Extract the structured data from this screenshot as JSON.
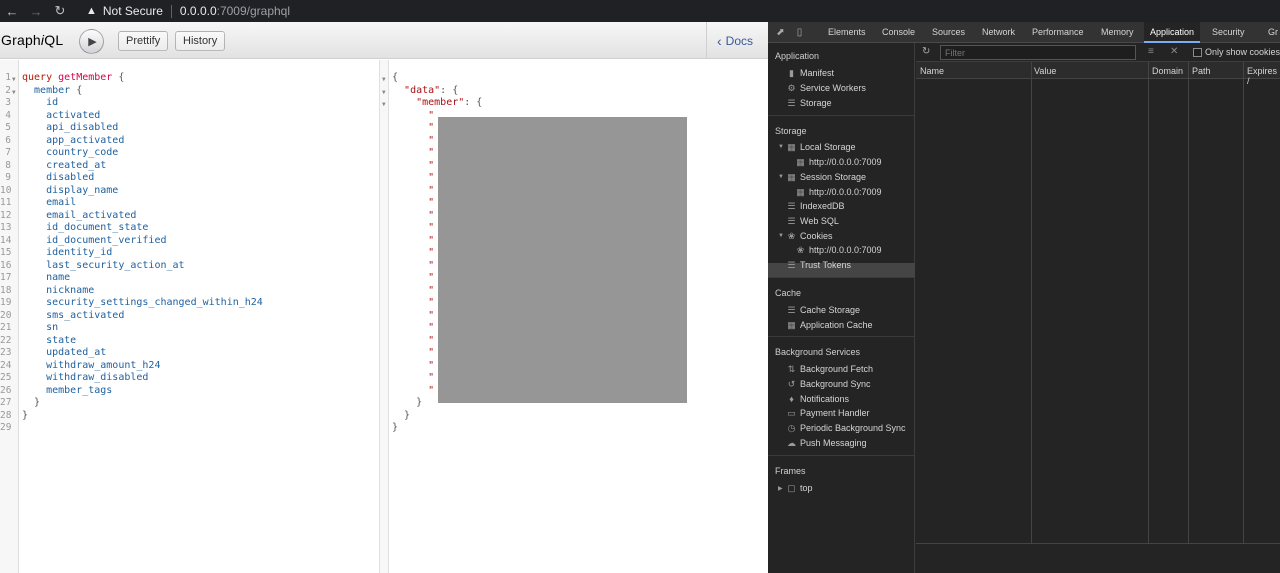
{
  "browser": {
    "security_label": "Not Secure",
    "url_host": "0.0.0.0",
    "url_path": ":7009/graphql"
  },
  "graphiql": {
    "title_prefix": "Graph",
    "title_italic": "i",
    "title_suffix": "QL",
    "prettify_label": "Prettify",
    "history_label": "History",
    "docs_label": "Docs",
    "query_lines": [
      {
        "n": "1",
        "fold": true,
        "parts": [
          {
            "t": "query",
            "c": "kw"
          },
          {
            "t": " ",
            "c": ""
          },
          {
            "t": "getMember",
            "c": "def"
          },
          {
            "t": " {",
            "c": "punc"
          }
        ]
      },
      {
        "n": "2",
        "fold": true,
        "parts": [
          {
            "t": "  member",
            "c": "prop"
          },
          {
            "t": " {",
            "c": "punc"
          }
        ]
      },
      {
        "n": "3",
        "parts": [
          {
            "t": "    id",
            "c": "prop"
          }
        ]
      },
      {
        "n": "4",
        "parts": [
          {
            "t": "    activated",
            "c": "prop"
          }
        ]
      },
      {
        "n": "5",
        "parts": [
          {
            "t": "    api_disabled",
            "c": "prop"
          }
        ]
      },
      {
        "n": "6",
        "parts": [
          {
            "t": "    app_activated",
            "c": "prop"
          }
        ]
      },
      {
        "n": "7",
        "parts": [
          {
            "t": "    country_code",
            "c": "prop"
          }
        ]
      },
      {
        "n": "8",
        "parts": [
          {
            "t": "    created_at",
            "c": "prop"
          }
        ]
      },
      {
        "n": "9",
        "parts": [
          {
            "t": "    disabled",
            "c": "prop"
          }
        ]
      },
      {
        "n": "10",
        "parts": [
          {
            "t": "    display_name",
            "c": "prop"
          }
        ]
      },
      {
        "n": "11",
        "parts": [
          {
            "t": "    email",
            "c": "prop"
          }
        ]
      },
      {
        "n": "12",
        "parts": [
          {
            "t": "    email_activated",
            "c": "prop"
          }
        ]
      },
      {
        "n": "13",
        "parts": [
          {
            "t": "    id_document_state",
            "c": "prop"
          }
        ]
      },
      {
        "n": "14",
        "parts": [
          {
            "t": "    id_document_verified",
            "c": "prop"
          }
        ]
      },
      {
        "n": "15",
        "parts": [
          {
            "t": "    identity_id",
            "c": "prop"
          }
        ]
      },
      {
        "n": "16",
        "parts": [
          {
            "t": "    last_security_action_at",
            "c": "prop"
          }
        ]
      },
      {
        "n": "17",
        "parts": [
          {
            "t": "    name",
            "c": "prop"
          }
        ]
      },
      {
        "n": "18",
        "parts": [
          {
            "t": "    nickname",
            "c": "prop"
          }
        ]
      },
      {
        "n": "19",
        "parts": [
          {
            "t": "    security_settings_changed_within_h24",
            "c": "prop"
          }
        ]
      },
      {
        "n": "20",
        "parts": [
          {
            "t": "    sms_activated",
            "c": "prop"
          }
        ]
      },
      {
        "n": "21",
        "parts": [
          {
            "t": "    sn",
            "c": "prop"
          }
        ]
      },
      {
        "n": "22",
        "parts": [
          {
            "t": "    state",
            "c": "prop"
          }
        ]
      },
      {
        "n": "23",
        "parts": [
          {
            "t": "    updated_at",
            "c": "prop"
          }
        ]
      },
      {
        "n": "24",
        "parts": [
          {
            "t": "    withdraw_amount_h24",
            "c": "prop"
          }
        ]
      },
      {
        "n": "25",
        "parts": [
          {
            "t": "    withdraw_disabled",
            "c": "prop"
          }
        ]
      },
      {
        "n": "26",
        "parts": [
          {
            "t": "    member_tags",
            "c": "prop"
          }
        ]
      },
      {
        "n": "27",
        "parts": [
          {
            "t": "  }",
            "c": "punc"
          }
        ]
      },
      {
        "n": "28",
        "parts": [
          {
            "t": "}",
            "c": "punc"
          }
        ]
      },
      {
        "n": "29",
        "parts": []
      }
    ],
    "result_lines": [
      {
        "fold": true,
        "parts": [
          {
            "t": "{",
            "c": "punc"
          }
        ]
      },
      {
        "fold": true,
        "parts": [
          {
            "t": "  ",
            "c": ""
          },
          {
            "t": "\"data\"",
            "c": "key"
          },
          {
            "t": ": {",
            "c": "punc"
          }
        ]
      },
      {
        "fold": true,
        "parts": [
          {
            "t": "    ",
            "c": ""
          },
          {
            "t": "\"member\"",
            "c": "key"
          },
          {
            "t": ": {",
            "c": "punc"
          }
        ]
      },
      {
        "parts": [
          {
            "t": "      \"",
            "c": "key"
          }
        ]
      },
      {
        "parts": [
          {
            "t": "      \"",
            "c": "key"
          }
        ]
      },
      {
        "parts": [
          {
            "t": "      \"",
            "c": "key"
          }
        ]
      },
      {
        "parts": [
          {
            "t": "      \"",
            "c": "key"
          }
        ]
      },
      {
        "parts": [
          {
            "t": "      \"",
            "c": "key"
          }
        ]
      },
      {
        "parts": [
          {
            "t": "      \"",
            "c": "key"
          }
        ]
      },
      {
        "parts": [
          {
            "t": "      \"",
            "c": "key"
          }
        ]
      },
      {
        "parts": [
          {
            "t": "      \"",
            "c": "key"
          }
        ]
      },
      {
        "parts": [
          {
            "t": "      \"",
            "c": "key"
          }
        ]
      },
      {
        "parts": [
          {
            "t": "      \"",
            "c": "key"
          }
        ]
      },
      {
        "parts": [
          {
            "t": "      \"",
            "c": "key"
          }
        ]
      },
      {
        "parts": [
          {
            "t": "      \"",
            "c": "key"
          }
        ]
      },
      {
        "parts": [
          {
            "t": "      \"",
            "c": "key"
          }
        ]
      },
      {
        "parts": [
          {
            "t": "      \"",
            "c": "key"
          }
        ]
      },
      {
        "parts": [
          {
            "t": "      \"",
            "c": "key"
          }
        ]
      },
      {
        "parts": [
          {
            "t": "      \"",
            "c": "key"
          }
        ]
      },
      {
        "parts": [
          {
            "t": "      \"",
            "c": "key"
          }
        ]
      },
      {
        "parts": [
          {
            "t": "      \"",
            "c": "key"
          }
        ]
      },
      {
        "parts": [
          {
            "t": "      \"",
            "c": "key"
          }
        ]
      },
      {
        "parts": [
          {
            "t": "      \"",
            "c": "key"
          }
        ]
      },
      {
        "parts": [
          {
            "t": "      \"",
            "c": "key"
          }
        ]
      },
      {
        "parts": [
          {
            "t": "      \"",
            "c": "key"
          }
        ]
      },
      {
        "parts": [
          {
            "t": "      \"",
            "c": "key"
          }
        ]
      },
      {
        "parts": [
          {
            "t": "    }",
            "c": "punc"
          }
        ]
      },
      {
        "parts": [
          {
            "t": "  }",
            "c": "punc"
          }
        ]
      },
      {
        "parts": [
          {
            "t": "}",
            "c": "punc"
          }
        ]
      }
    ]
  },
  "devtools": {
    "tabs": [
      "Elements",
      "Console",
      "Sources",
      "Network",
      "Performance",
      "Memory",
      "Application",
      "Security",
      "Gr"
    ],
    "active_tab": "Application",
    "sections": {
      "application": "Application",
      "storage": "Storage",
      "cache": "Cache",
      "background": "Background Services",
      "frames": "Frames"
    },
    "items": {
      "manifest": "Manifest",
      "service_workers": "Service Workers",
      "storage": "Storage",
      "local_storage": "Local Storage",
      "local_storage_origin": "http://0.0.0.0:7009",
      "session_storage": "Session Storage",
      "session_storage_origin": "http://0.0.0.0:7009",
      "indexeddb": "IndexedDB",
      "websql": "Web SQL",
      "cookies": "Cookies",
      "cookies_origin": "http://0.0.0.0:7009",
      "trust_tokens": "Trust Tokens",
      "cache_storage": "Cache Storage",
      "application_cache": "Application Cache",
      "background_fetch": "Background Fetch",
      "background_sync": "Background Sync",
      "notifications": "Notifications",
      "payment_handler": "Payment Handler",
      "periodic_background_sync": "Periodic Background Sync",
      "push_messaging": "Push Messaging",
      "frames_top": "top"
    },
    "filter_placeholder": "Filter",
    "only_show_cookies": "Only show cookies",
    "columns": [
      "Name",
      "Value",
      "Domain",
      "Path",
      "Expires /"
    ]
  }
}
